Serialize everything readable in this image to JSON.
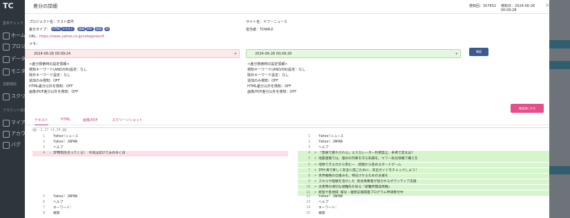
{
  "background": {
    "logo": "TC",
    "sidebar_items": [
      "ホーム",
      "プロジ",
      "データ",
      "モニタ",
      "スクリー",
      "マイア",
      "アカウ",
      "バグ"
    ],
    "sidebar_sections": [
      "基本チェック",
      "自動機能",
      "アカウント管理"
    ],
    "right_items": [
      "",
      "",
      "",
      ""
    ],
    "accent_color": "#2f5f6e"
  },
  "modal": {
    "title": "差分の詳細",
    "check_count_label": "検知回：357652",
    "detected_at_label": "検知日：2024-06-26 00:09:28",
    "close_label": "×"
  },
  "meta": {
    "project_label": "プロジェクト名：テスト案件",
    "site_label": "サイト名：ヤフーニュース",
    "diff_type_label": "差分タイプ：",
    "badges": [
      "HTML",
      "テキスト",
      "画像",
      "PDF",
      "画面",
      "ID"
    ],
    "assignee_label": "担当者：TOWA子",
    "url_label": "URL：",
    "url": "https://news.yahoo.co.jp/categories/it",
    "memo_label": "メモ："
  },
  "compare": {
    "left_datetime": "2024-06-26 00:09:24",
    "right_datetime": "2024-06-26 00:09:28",
    "caret": "▾",
    "confirm_button": "確認"
  },
  "settings": {
    "left": [
      "<差分検索時の設定情報>",
      "検知キーワード(AND/OR)設定：なし",
      "除外キーワード設定：なし",
      "追加のみ検知：OFF",
      "HTML差分以外を検知：OFF",
      "画像/PDF差分以外を検知：OFF"
    ],
    "right": [
      "<差分検索時の設定情報>",
      "検知キーワード(AND/OR)設定：なし",
      "除外キーワード設定：なし",
      "追加のみ検知：OFF",
      "HTML差分以外を検知：OFF",
      "画像/PDF差分以外を検知：OFF"
    ]
  },
  "actions": {
    "mark_checked": "確認済にする"
  },
  "tabs": [
    "テキスト",
    "HTML",
    "画像/PDF",
    "スクリーンショット"
  ],
  "diff": {
    "hunk_header": "@@ -1,17 +1,24 @@",
    "left_lines": [
      {
        "n": "1",
        "m": "",
        "t": "Yahoo!ニュース",
        "k": "ctx"
      },
      {
        "n": "2",
        "m": "",
        "t": "Yahoo! JAPAN",
        "k": "ctx"
      },
      {
        "n": "3",
        "m": "",
        "t": "ヘルプ",
        "k": "ctx"
      },
      {
        "n": "4",
        "m": "-",
        "t": "IP時刻を戻ってくる！ 今日はぼけてみのゆく日",
        "k": "del"
      }
    ],
    "left_bottom": [
      {
        "n": "5",
        "m": "",
        "t": "Yahoo! JAPAN",
        "k": "ctx"
      },
      {
        "n": "6",
        "m": "",
        "t": "ヘルプ",
        "k": "ctx"
      },
      {
        "n": "7",
        "m": "",
        "t": "キーワード：",
        "k": "ctx"
      },
      {
        "n": "8",
        "m": "",
        "t": "検索",
        "k": "ctx"
      }
    ],
    "right_lines": [
      {
        "n": "1",
        "m": "",
        "t": "Yahoo!ニュース",
        "k": "ctx"
      },
      {
        "n": "2",
        "m": "",
        "t": "Yahoo! JAPAN",
        "k": "ctx"
      },
      {
        "n": "3",
        "m": "",
        "t": "ヘルプ",
        "k": "ctx"
      },
      {
        "n": "4",
        "m": "+",
        "t": "「音楽で癒やされる」エスカレーター利用禁止、条例で変化は？",
        "k": "add"
      },
      {
        "n": "5",
        "m": "+",
        "t": "地震速報では、速めの列車を守る知識を。ヤフー防災情報で備えを",
        "k": "add"
      },
      {
        "n": "6",
        "m": "+",
        "t": "地球できる力から育む一　結婚から進めるボードゲーム",
        "k": "add"
      },
      {
        "n": "7",
        "m": "+",
        "t": "IHや海で楽しく安全に過ごために、安全ガイドをチェックしよう！",
        "k": "add"
      },
      {
        "n": "8",
        "m": "+",
        "t": "世界戦略の仕組みを。特記させるための支援を",
        "k": "add"
      },
      {
        "n": "9",
        "m": "+",
        "t": "スキルや経験を活かした 各会事業者が協力するボランティア支援",
        "k": "add"
      },
      {
        "n": "10",
        "m": "+",
        "t": "災害時の適切な避難先を知る「避難所開設情報」",
        "k": "add"
      },
      {
        "n": "11",
        "m": "+",
        "t": "新型や各地域 被災・連携支援関連プログラム申請受付中",
        "k": "add"
      }
    ],
    "right_bottom": [
      {
        "n": "12",
        "m": "",
        "t": "Yahoo! JAPAN",
        "k": "ctx"
      },
      {
        "n": "13",
        "m": "",
        "t": "ヘルプ",
        "k": "ctx"
      },
      {
        "n": "14",
        "m": "",
        "t": "キーワード：",
        "k": "ctx"
      },
      {
        "n": "15",
        "m": "",
        "t": "検索",
        "k": "ctx"
      }
    ]
  }
}
